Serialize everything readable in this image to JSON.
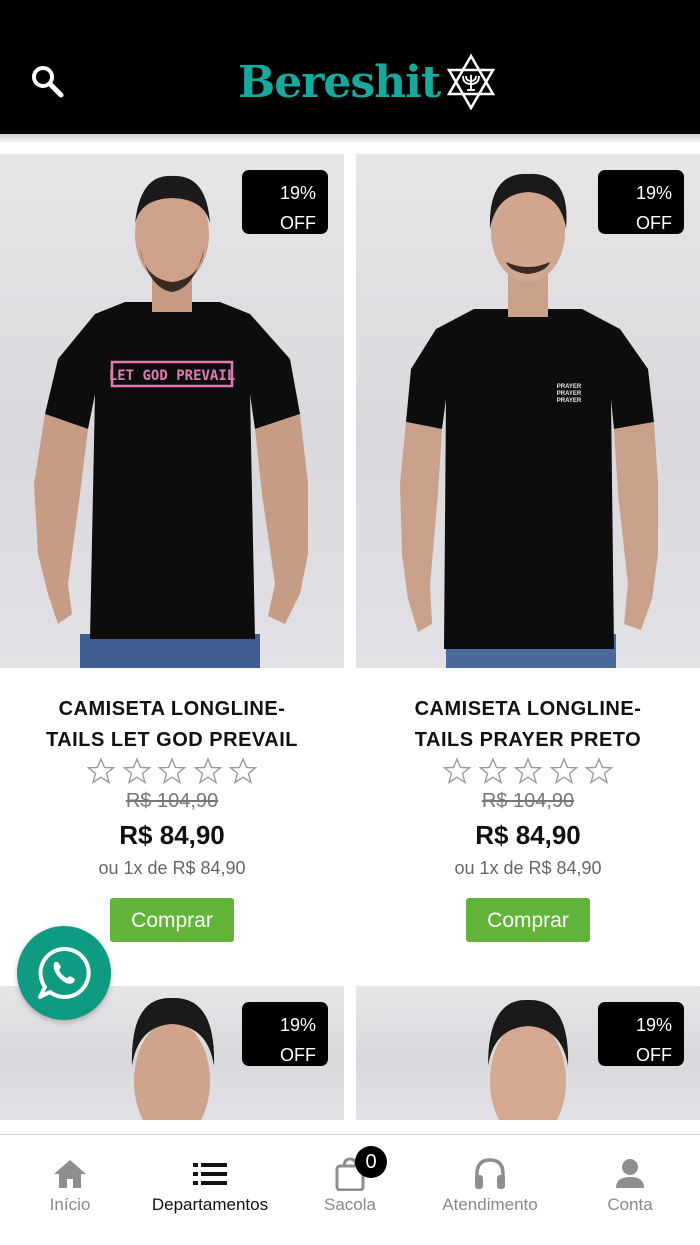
{
  "header": {
    "logo_text": "Bereshit",
    "search_icon": "search-icon",
    "logo_mark": "star-of-david-menorah"
  },
  "colors": {
    "brand": "#17a89e",
    "buy_button": "#62b33a",
    "whatsapp": "#0e9b82"
  },
  "products": [
    {
      "badge_percent": "19%",
      "badge_off": "OFF",
      "title_line1": "CAMISETA LONGLINE-",
      "title_line2": "TAILS LET GOD PREVAIL",
      "rating": 0,
      "old_price": "R$ 104,90",
      "price": "R$ 84,90",
      "installment": "ou 1x de R$ 84,90",
      "buy_label": "Comprar",
      "shirt_print": "LET GOD PREVAIL"
    },
    {
      "badge_percent": "19%",
      "badge_off": "OFF",
      "title_line1": "CAMISETA LONGLINE-",
      "title_line2": "TAILS PRAYER PRETO",
      "rating": 0,
      "old_price": "R$ 104,90",
      "price": "R$ 84,90",
      "installment": "ou 1x de R$ 84,90",
      "buy_label": "Comprar",
      "shirt_print": "PRAYER PRAYER PRAYER"
    },
    {
      "badge_percent": "19%",
      "badge_off": "OFF"
    },
    {
      "badge_percent": "19%",
      "badge_off": "OFF"
    }
  ],
  "whatsapp_icon": "whatsapp-icon",
  "bag_count": "0",
  "nav": [
    {
      "label": "Início",
      "icon": "home-icon"
    },
    {
      "label": "Departamentos",
      "icon": "list-icon",
      "active": true
    },
    {
      "label": "Sacola",
      "icon": "bag-icon"
    },
    {
      "label": "Atendimento",
      "icon": "headset-icon"
    },
    {
      "label": "Conta",
      "icon": "user-icon"
    }
  ]
}
